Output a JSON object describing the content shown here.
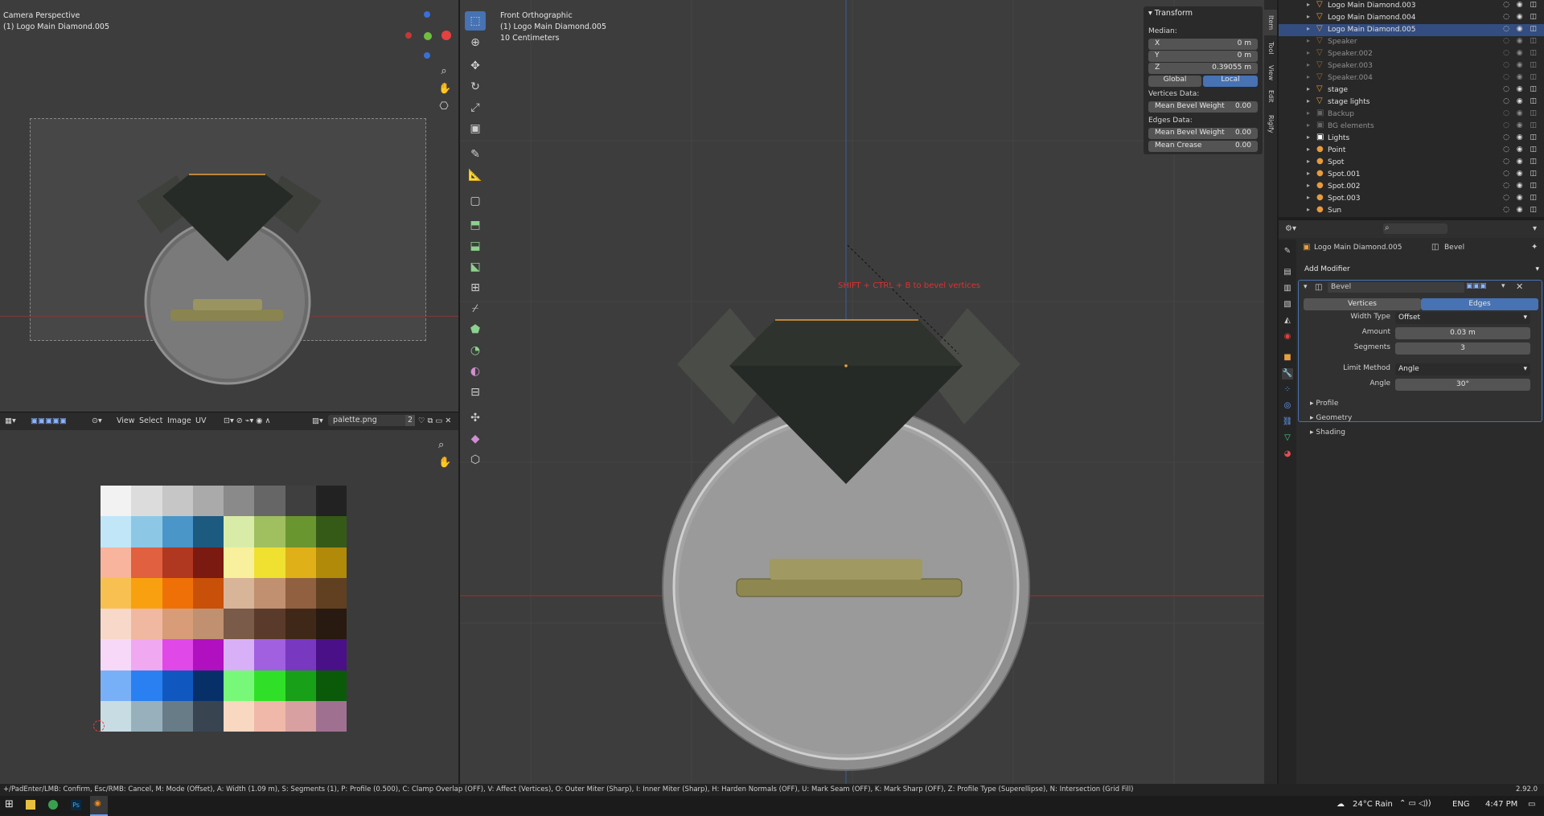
{
  "camera_view": {
    "title": "Camera Perspective",
    "object": "(1) Logo Main Diamond.005"
  },
  "image_editor": {
    "menu": [
      "View",
      "Select",
      "Image",
      "UV"
    ],
    "image_name": "palette.png",
    "users": "2",
    "palette_colors": [
      "#f2f2f2",
      "#dcdcdc",
      "#c6c6c6",
      "#aaaaaa",
      "#8a8a8a",
      "#666666",
      "#3f3f3f",
      "#222222",
      "#c0e6f8",
      "#8cc8e6",
      "#4a96c8",
      "#1c5a80",
      "#d8eca8",
      "#a0c060",
      "#6a9630",
      "#355a18",
      "#f8b49c",
      "#e06040",
      "#b03820",
      "#7a1a10",
      "#f8f09c",
      "#f0e030",
      "#e0b018",
      "#b08a08",
      "#f8c050",
      "#f8a010",
      "#f07008",
      "#c85008",
      "#d8b498",
      "#c09070",
      "#906040",
      "#604020",
      "#f8d8c8",
      "#f0b8a0",
      "#d89c78",
      "#c09070",
      "#7a5a48",
      "#5a3a2a",
      "#402818",
      "#281a10",
      "#f8d8f8",
      "#f0a8f0",
      "#e048e8",
      "#b010c0",
      "#d8b0f8",
      "#a060e0",
      "#7838c0",
      "#4a1088",
      "#78b0f8",
      "#2a80f0",
      "#1058c0",
      "#083068",
      "#78f878",
      "#30e028",
      "#18a018",
      "#0a5a0a",
      "#c8dce4",
      "#98b0bc",
      "#687c88",
      "#384450",
      "#f8d8c0",
      "#f0b8a8",
      "#d8a0a0",
      "#a07090"
    ]
  },
  "main_view": {
    "title": "Front Orthographic",
    "object": "(1) Logo Main Diamond.005",
    "scale": "10 Centimeters",
    "overlay_text": "SHIFT + CTRL + B to bevel vertices"
  },
  "npanel": {
    "section": "Transform",
    "median_label": "Median:",
    "x": {
      "label": "X",
      "value": "0 m"
    },
    "y": {
      "label": "Y",
      "value": "0 m"
    },
    "z": {
      "label": "Z",
      "value": "0.39055 m"
    },
    "global": "Global",
    "local": "Local",
    "vertices_data": "Vertices Data:",
    "v_bevel": {
      "label": "Mean Bevel Weight",
      "value": "0.00"
    },
    "edges_data": "Edges Data:",
    "e_bevel": {
      "label": "Mean Bevel Weight",
      "value": "0.00"
    },
    "e_crease": {
      "label": "Mean Crease",
      "value": "0.00"
    },
    "tabs": [
      "Item",
      "Tool",
      "View",
      "Edit",
      "Rigify"
    ]
  },
  "outliner": {
    "rows": [
      {
        "name": "Logo Main Diamond.003",
        "icon": "▽",
        "color": "#e89a3c",
        "selected": false,
        "dim": false
      },
      {
        "name": "Logo Main Diamond.004",
        "icon": "▽",
        "color": "#e89a3c",
        "selected": false,
        "dim": false
      },
      {
        "name": "Logo Main Diamond.005",
        "icon": "▽",
        "color": "#e89a3c",
        "selected": true,
        "dim": false
      },
      {
        "name": "Speaker",
        "icon": "▽",
        "color": "#e89a3c",
        "selected": false,
        "dim": true
      },
      {
        "name": "Speaker.002",
        "icon": "▽",
        "color": "#e89a3c",
        "selected": false,
        "dim": true
      },
      {
        "name": "Speaker.003",
        "icon": "▽",
        "color": "#e89a3c",
        "selected": false,
        "dim": true
      },
      {
        "name": "Speaker.004",
        "icon": "▽",
        "color": "#e89a3c",
        "selected": false,
        "dim": true
      },
      {
        "name": "stage",
        "icon": "▽",
        "color": "#e89a3c",
        "selected": false,
        "dim": false
      },
      {
        "name": "stage lights",
        "icon": "▽",
        "color": "#e89a3c",
        "selected": false,
        "dim": false
      },
      {
        "name": "Backup",
        "icon": "▣",
        "color": "#9a9a9a",
        "selected": false,
        "dim": true
      },
      {
        "name": "BG elements",
        "icon": "▣",
        "color": "#9a9a9a",
        "selected": false,
        "dim": true
      },
      {
        "name": "Lights",
        "icon": "▣",
        "color": "#ffffff",
        "selected": false,
        "dim": false
      },
      {
        "name": "Point",
        "icon": "●",
        "color": "#e89a3c",
        "selected": false,
        "dim": false
      },
      {
        "name": "Spot",
        "icon": "●",
        "color": "#e89a3c",
        "selected": false,
        "dim": false
      },
      {
        "name": "Spot.001",
        "icon": "●",
        "color": "#e89a3c",
        "selected": false,
        "dim": false
      },
      {
        "name": "Spot.002",
        "icon": "●",
        "color": "#e89a3c",
        "selected": false,
        "dim": false
      },
      {
        "name": "Spot.003",
        "icon": "●",
        "color": "#e89a3c",
        "selected": false,
        "dim": false
      },
      {
        "name": "Sun",
        "icon": "●",
        "color": "#e89a3c",
        "selected": false,
        "dim": false
      }
    ]
  },
  "properties": {
    "object_name": "Logo Main Diamond.005",
    "modifier_crumb": "Bevel",
    "add_modifier": "Add Modifier",
    "modifier_name": "Bevel",
    "vertices": "Vertices",
    "edges": "Edges",
    "width_type": {
      "label": "Width Type",
      "value": "Offset"
    },
    "amount": {
      "label": "Amount",
      "value": "0.03 m"
    },
    "segments": {
      "label": "Segments",
      "value": "3"
    },
    "limit_method": {
      "label": "Limit Method",
      "value": "Angle"
    },
    "angle": {
      "label": "Angle",
      "value": "30°"
    },
    "panels": [
      "Profile",
      "Geometry",
      "Shading"
    ]
  },
  "status_bar": {
    "text": "+/PadEnter/LMB: Confirm, Esc/RMB: Cancel, M: Mode (Offset), A: Width (1.09 m), S: Segments (1), P: Profile (0.500), C: Clamp Overlap (OFF), V: Affect (Vertices), O: Outer Miter (Sharp), I: Inner Miter (Sharp), H: Harden Normals (OFF), U: Mark Seam (OFF), K: Mark Sharp (OFF), Z: Profile Type (Superellipse), N: Intersection (Grid Fill)",
    "version": "2.92.0"
  },
  "taskbar": {
    "weather": "24°C  Rain",
    "lang": "ENG",
    "time": "4:47 PM"
  },
  "colors": {
    "accent": "#4772b3",
    "selection_orange": "#e8a040",
    "overlay_red": "#e03030"
  }
}
